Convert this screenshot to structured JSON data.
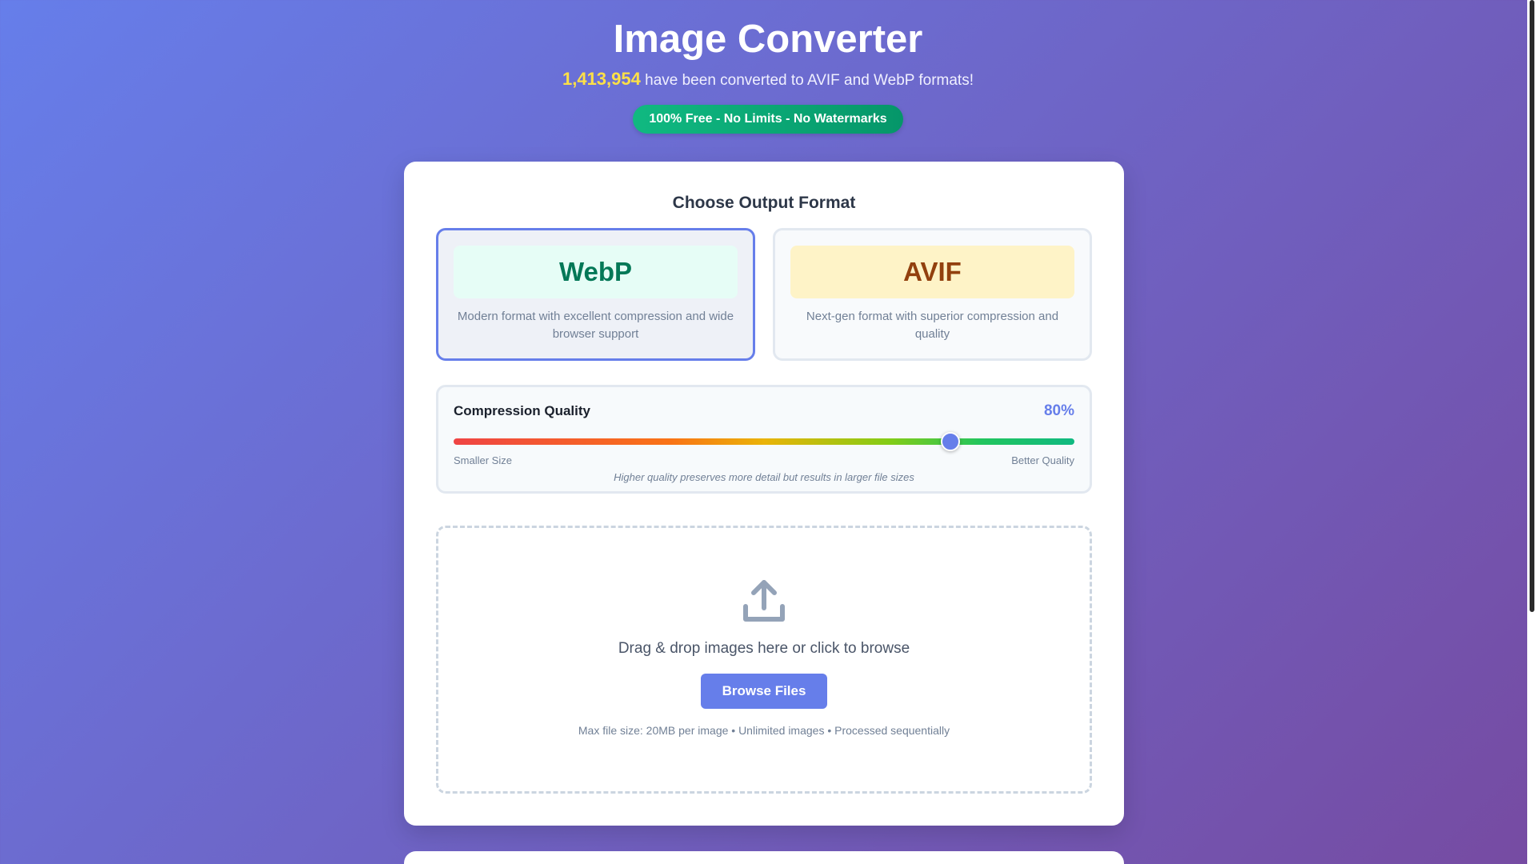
{
  "header": {
    "title": "Image Converter",
    "count": "1,413,954",
    "subtitle_rest": " have been converted to AVIF and WebP formats!",
    "badge": "100% Free - No Limits - No Watermarks"
  },
  "format_section": {
    "title": "Choose Output Format",
    "options": [
      {
        "name": "WebP",
        "description": "Modern format with excellent compression and wide browser support",
        "selected": true
      },
      {
        "name": "AVIF",
        "description": "Next-gen format with superior compression and quality",
        "selected": false
      }
    ]
  },
  "quality": {
    "label": "Compression Quality",
    "value_text": "80%",
    "value": 0.8,
    "min_label": "Smaller Size",
    "max_label": "Better Quality",
    "note": "Higher quality preserves more detail but results in larger file sizes"
  },
  "dropzone": {
    "icon": "upload-icon",
    "text": "Drag & drop images here or click to browse",
    "button": "Browse Files",
    "info": "Max file size: 20MB per image • Unlimited images • Processed sequentially"
  },
  "colors": {
    "accent": "#667eea",
    "badge": "#10b981",
    "count": "#fde047"
  }
}
